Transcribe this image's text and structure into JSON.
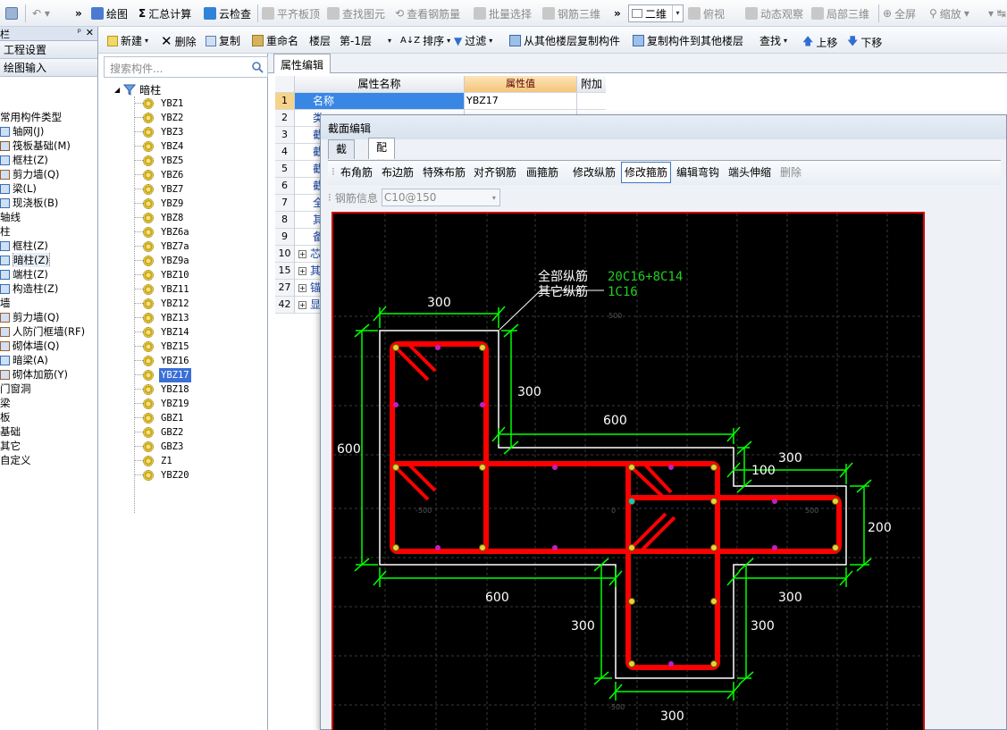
{
  "toolbar1": {
    "draw": "绘图",
    "summary_calc": "汇总计算",
    "cloud_check": "云检查",
    "flat_slab_top": "平齐板顶",
    "find_element": "查找图元",
    "view_rebar_qty": "查看钢筋量",
    "batch_select": "批量选择",
    "rebar_3d": "钢筋三维",
    "view_mode": "二维",
    "top_view": "俯视",
    "dynamic_observe": "动态观察",
    "partial_3d": "局部三维",
    "fullscreen": "全屏",
    "zoom": "缩放"
  },
  "left_panel": {
    "title_fragment": "栏",
    "project_settings": "工程设置",
    "drawing_input": "绘图输入",
    "tree": [
      {
        "label": "常用构件类型",
        "icon": "none",
        "indent": 0
      },
      {
        "label": "轴网(J)",
        "icon": "grid",
        "indent": 1
      },
      {
        "label": "筏板基础(M)",
        "icon": "raft",
        "indent": 1
      },
      {
        "label": "框柱(Z)",
        "icon": "column",
        "indent": 1
      },
      {
        "label": "剪力墙(Q)",
        "icon": "wall",
        "indent": 1
      },
      {
        "label": "梁(L)",
        "icon": "beam",
        "indent": 1
      },
      {
        "label": "现浇板(B)",
        "icon": "slab",
        "indent": 1
      },
      {
        "label": "轴线",
        "icon": "none",
        "indent": 0
      },
      {
        "label": "柱",
        "icon": "none",
        "indent": 0
      },
      {
        "label": "框柱(Z)",
        "icon": "column",
        "indent": 1
      },
      {
        "label": "暗柱(Z)",
        "icon": "column",
        "indent": 1,
        "selected": true
      },
      {
        "label": "端柱(Z)",
        "icon": "column",
        "indent": 1
      },
      {
        "label": "构造柱(Z)",
        "icon": "column",
        "indent": 1
      },
      {
        "label": "墙",
        "icon": "none",
        "indent": 0
      },
      {
        "label": "剪力墙(Q)",
        "icon": "wall",
        "indent": 1
      },
      {
        "label": "人防门框墙(RF)",
        "icon": "wall",
        "indent": 1
      },
      {
        "label": "砌体墙(Q)",
        "icon": "wall",
        "indent": 1
      },
      {
        "label": "暗梁(A)",
        "icon": "beam",
        "indent": 1
      },
      {
        "label": "砌体加筋(Y)",
        "icon": "wall",
        "indent": 1
      },
      {
        "label": "门窗洞",
        "icon": "none",
        "indent": 0
      },
      {
        "label": "梁",
        "icon": "none",
        "indent": 0
      },
      {
        "label": "板",
        "icon": "none",
        "indent": 0
      },
      {
        "label": "基础",
        "icon": "none",
        "indent": 0
      },
      {
        "label": "其它",
        "icon": "none",
        "indent": 0
      },
      {
        "label": "自定义",
        "icon": "none",
        "indent": 0
      }
    ]
  },
  "toolbar2": {
    "new": "新建",
    "delete": "删除",
    "copy": "复制",
    "rename": "重命名",
    "floor_label": "楼层",
    "floor_value": "第-1层",
    "sort": "排序",
    "filter": "过滤",
    "copy_from_other_floor": "从其他楼层复制构件",
    "copy_to_other_floor": "复制构件到其他楼层",
    "find": "查找",
    "move_up": "上移",
    "move_down": "下移"
  },
  "component_list": {
    "search_placeholder": "搜索构件...",
    "root": "暗柱",
    "items": [
      "YBZ1",
      "YBZ2",
      "YBZ3",
      "YBZ4",
      "YBZ5",
      "YBZ6",
      "YBZ7",
      "YBZ9",
      "YBZ8",
      "YBZ6a",
      "YBZ7a",
      "YBZ9a",
      "YBZ10",
      "YBZ11",
      "YBZ12",
      "YBZ13",
      "YBZ14",
      "YBZ15",
      "YBZ16",
      "YBZ17",
      "YBZ18",
      "YBZ19",
      "GBZ1",
      "GBZ2",
      "GBZ3",
      "Z1",
      "YBZ20"
    ],
    "selected": "YBZ17"
  },
  "property_editor": {
    "tab": "属性编辑",
    "headers": {
      "name": "属性名称",
      "value": "属性值",
      "extra": "附加"
    },
    "rows": [
      {
        "num": "1",
        "name": "名称",
        "value": "YBZ17",
        "highlight": true
      },
      {
        "num": "2",
        "name": "类",
        "value": ""
      },
      {
        "num": "3",
        "name": "截",
        "value": ""
      },
      {
        "num": "4",
        "name": "截",
        "value": ""
      },
      {
        "num": "5",
        "name": "截",
        "value": ""
      },
      {
        "num": "6",
        "name": "截",
        "value": ""
      },
      {
        "num": "7",
        "name": "全",
        "value": ""
      },
      {
        "num": "8",
        "name": "其",
        "value": ""
      },
      {
        "num": "9",
        "name": "备",
        "value": ""
      },
      {
        "num": "10",
        "name": "芯",
        "value": "",
        "expand": true
      },
      {
        "num": "15",
        "name": "其",
        "value": "",
        "expand": true
      },
      {
        "num": "27",
        "name": "锚",
        "value": "",
        "expand": true
      },
      {
        "num": "42",
        "name": "显",
        "value": "",
        "expand": true
      }
    ]
  },
  "section_dialog": {
    "title": "截面编辑",
    "tabs": [
      "截面",
      "配筋"
    ],
    "active_tab": "配筋",
    "tools": [
      "布角筋",
      "布边筋",
      "特殊布筋",
      "对齐钢筋",
      "画箍筋",
      "修改纵筋",
      "修改箍筋",
      "编辑弯钩",
      "端头伸缩",
      "删除"
    ],
    "active_tool": "修改箍筋",
    "disabled_tool": "删除",
    "rebar_info_label": "钢筋信息",
    "rebar_info_value": "C10@150"
  },
  "drawing": {
    "annot_all_label": "全部纵筋",
    "annot_all_value": "20C16+8C14",
    "annot_other_label": "其它纵筋",
    "annot_other_value": "1C16",
    "dims": [
      "300",
      "300",
      "600",
      "600",
      "300",
      "100",
      "200",
      "600",
      "300",
      "300",
      "300",
      "300"
    ],
    "grid_labels": [
      "500",
      "-500",
      "0",
      "500",
      "-500"
    ],
    "colors": {
      "background": "#000000",
      "rebar": "#ff0000",
      "outline": "#ffffff",
      "dims": "#00ff00",
      "bar_dot": "#e8d23a",
      "mid_dot": "#c020c0",
      "annot_value": "#20d020"
    }
  }
}
